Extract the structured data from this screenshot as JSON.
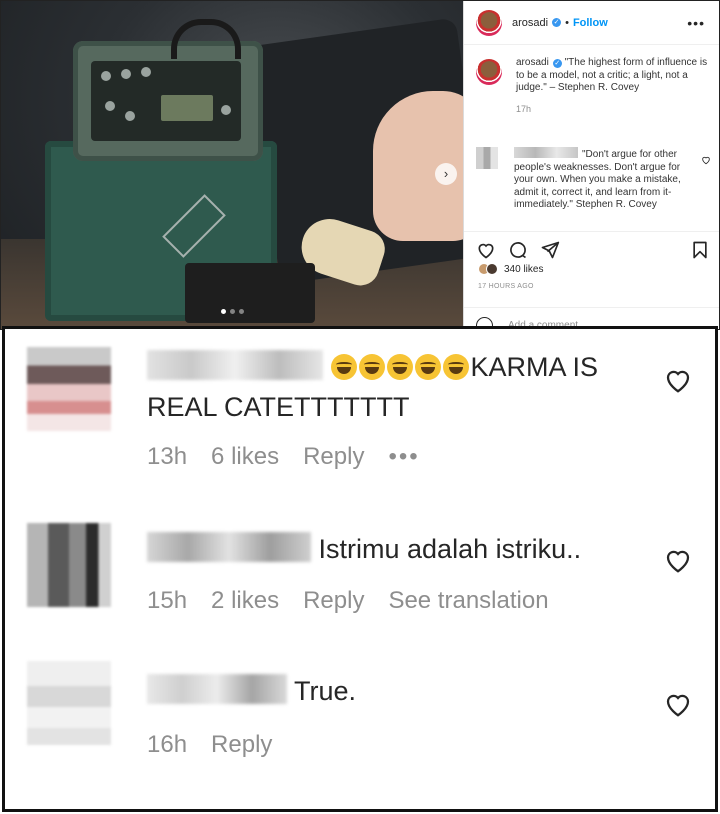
{
  "post": {
    "header": {
      "username": "arosadi",
      "separator": "•",
      "follow_label": "Follow",
      "more_icon": "more-horizontal-icon"
    },
    "caption": {
      "username": "arosadi",
      "text": "\"The highest form of influence is to be a model, not a critic; a light, not a judge.\" – Stephen R. Covey",
      "time": "17h"
    },
    "comment": {
      "text": "\"Don't argue for other people's weaknesses. Don't argue for your own. When you make a mistake, admit it, correct it, and learn from it- immediately.\" Stephen R. Covey"
    },
    "likes": "340 likes",
    "posted_ago": "17 HOURS AGO",
    "add_comment_placeholder": "Add a comment...",
    "colors": {
      "accent": "#0095f6",
      "muted": "#8e8e8e",
      "verified": "#3897f0"
    }
  },
  "zoomed_comments": [
    {
      "text_suffix": "KARMA IS REAL CATETTTTTTT",
      "emoji_count": 5,
      "time": "13h",
      "likes": "6 likes",
      "reply": "Reply",
      "more": "•••"
    },
    {
      "text_suffix": "Istrimu adalah istriku..",
      "time": "15h",
      "likes": "2 likes",
      "reply": "Reply",
      "see_translation": "See translation"
    },
    {
      "text_suffix": "True.",
      "time": "16h",
      "reply": "Reply"
    }
  ]
}
